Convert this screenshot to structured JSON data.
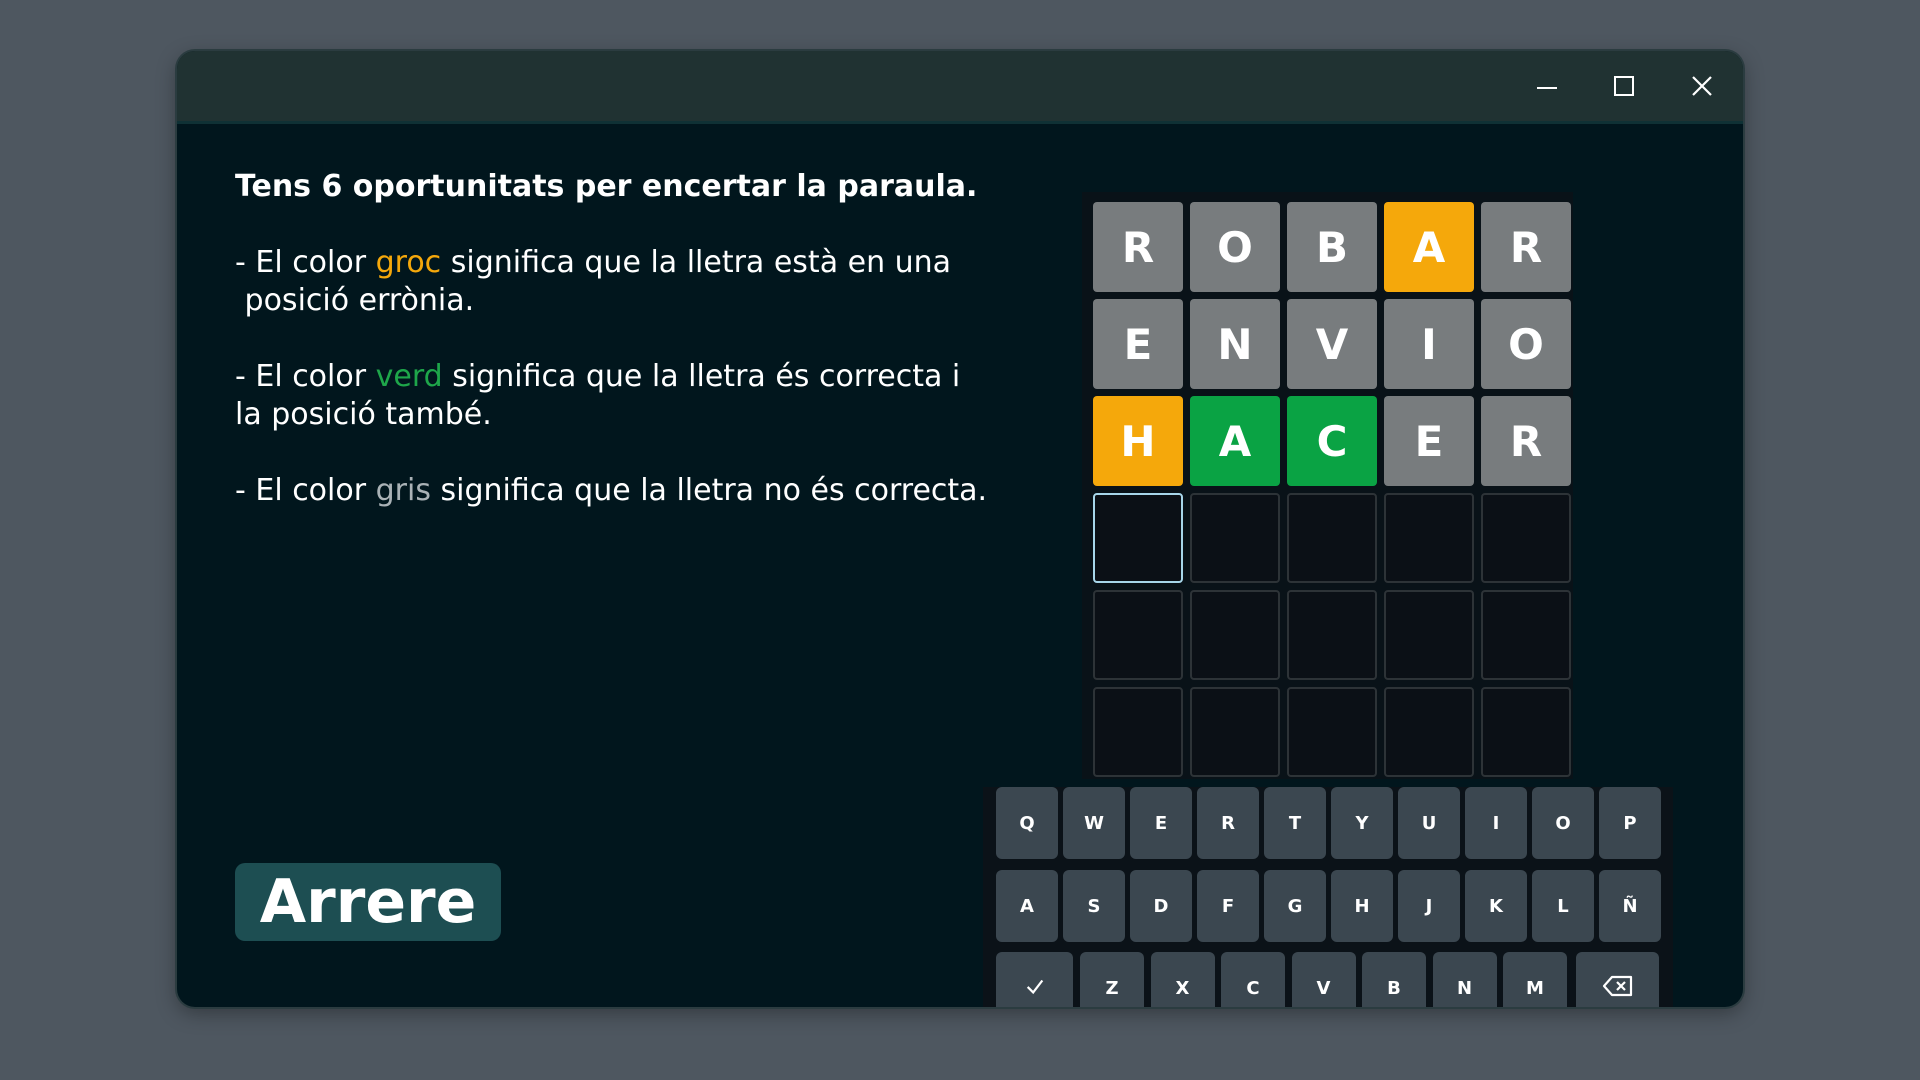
{
  "window": {
    "minimize_icon": "minimize-icon",
    "maximize_icon": "maximize-icon",
    "close_icon": "close-icon"
  },
  "instructions": {
    "title": "Tens 6 oportunitats per encertar la paraula.",
    "yellow": {
      "pre": "- El color ",
      "word": "groc",
      "line1_rest": " significa que la lletra està en una",
      "line2": " posició errònia."
    },
    "green": {
      "pre": "- El color ",
      "word": "verd",
      "line1_rest": " significa que la lletra és correcta i",
      "line2": "la posició també."
    },
    "gray": {
      "pre": "- El color ",
      "word": "gris",
      "rest": " significa que la lletra no és correcta."
    }
  },
  "back_button": "Arrere",
  "board": {
    "rows": [
      [
        {
          "letter": "R",
          "state": "gray"
        },
        {
          "letter": "O",
          "state": "gray"
        },
        {
          "letter": "B",
          "state": "gray"
        },
        {
          "letter": "A",
          "state": "yellow"
        },
        {
          "letter": "R",
          "state": "gray"
        }
      ],
      [
        {
          "letter": "E",
          "state": "gray"
        },
        {
          "letter": "N",
          "state": "gray"
        },
        {
          "letter": "V",
          "state": "gray"
        },
        {
          "letter": "I",
          "state": "gray"
        },
        {
          "letter": "O",
          "state": "gray"
        }
      ],
      [
        {
          "letter": "H",
          "state": "yellow"
        },
        {
          "letter": "A",
          "state": "green"
        },
        {
          "letter": "C",
          "state": "green"
        },
        {
          "letter": "E",
          "state": "gray"
        },
        {
          "letter": "R",
          "state": "gray"
        }
      ],
      [
        {
          "letter": "",
          "state": "active"
        },
        {
          "letter": "",
          "state": "empty"
        },
        {
          "letter": "",
          "state": "empty"
        },
        {
          "letter": "",
          "state": "empty"
        },
        {
          "letter": "",
          "state": "empty"
        }
      ],
      [
        {
          "letter": "",
          "state": "empty"
        },
        {
          "letter": "",
          "state": "empty"
        },
        {
          "letter": "",
          "state": "empty"
        },
        {
          "letter": "",
          "state": "empty"
        },
        {
          "letter": "",
          "state": "empty"
        }
      ],
      [
        {
          "letter": "",
          "state": "empty"
        },
        {
          "letter": "",
          "state": "empty"
        },
        {
          "letter": "",
          "state": "empty"
        },
        {
          "letter": "",
          "state": "empty"
        },
        {
          "letter": "",
          "state": "empty"
        }
      ]
    ]
  },
  "keyboard": {
    "row1": [
      "Q",
      "W",
      "E",
      "R",
      "T",
      "Y",
      "U",
      "I",
      "O",
      "P"
    ],
    "row2": [
      "A",
      "S",
      "D",
      "F",
      "G",
      "H",
      "J",
      "K",
      "L",
      "Ñ"
    ],
    "row3": [
      "Z",
      "X",
      "C",
      "V",
      "B",
      "N",
      "M"
    ],
    "enter_icon": "checkmark-icon",
    "backspace_icon": "backspace-icon"
  },
  "colors": {
    "yellow": "#f5a80b",
    "green": "#0aa344",
    "gray": "#787c7e",
    "key": "#3b4750",
    "button": "#1d4e52"
  }
}
